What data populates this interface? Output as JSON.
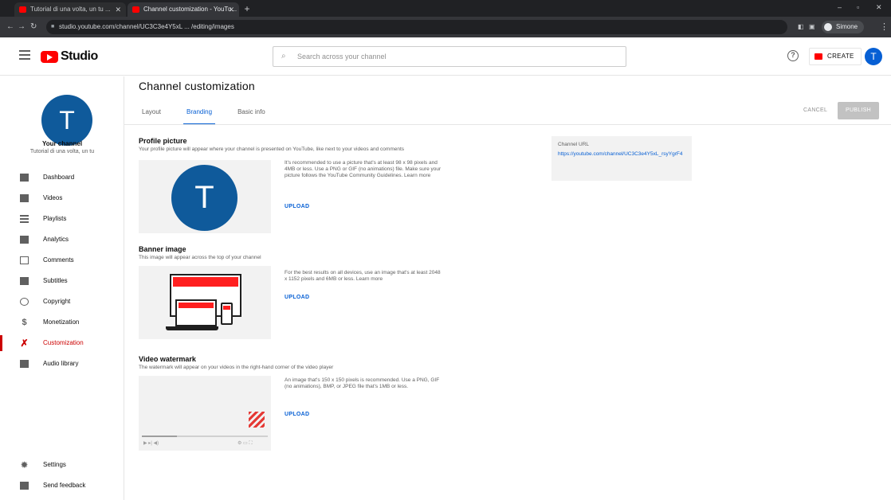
{
  "browser": {
    "tabs": [
      {
        "title": "Tutorial di una volta, un tu ..."
      },
      {
        "title": "Channel customization - YouTu..."
      }
    ],
    "new_tab": "+",
    "controls": {
      "minimize": "–",
      "maximize": "▫",
      "close": "✕"
    },
    "url": "studio.youtube.com/channel/UC3C3e4Y5xL ... /editing/images",
    "profile_label": "Simone",
    "menu": "⋮"
  },
  "header": {
    "logo_text": "Studio",
    "search_placeholder": "Search across your channel",
    "help": "?",
    "create_label": "CREATE",
    "avatar_initial": "T"
  },
  "sidebar": {
    "avatar_initial": "T",
    "channel_title": "Your channel",
    "channel_name": "Tutorial di una volta, un tu",
    "items": [
      {
        "label": "Dashboard",
        "icon": "dashboard-icon"
      },
      {
        "label": "Videos",
        "icon": "videos-icon"
      },
      {
        "label": "Playlists",
        "icon": "playlists-icon"
      },
      {
        "label": "Analytics",
        "icon": "analytics-icon"
      },
      {
        "label": "Comments",
        "icon": "comments-icon"
      },
      {
        "label": "Subtitles",
        "icon": "subtitles-icon"
      },
      {
        "label": "Copyright",
        "icon": "copyright-icon"
      },
      {
        "label": "Monetization",
        "icon": "monetization-icon"
      },
      {
        "label": "Customization",
        "icon": "customization-icon",
        "active": true
      },
      {
        "label": "Audio library",
        "icon": "audio-library-icon"
      }
    ],
    "bottom_items": [
      {
        "label": "Settings",
        "icon": "gear-icon"
      },
      {
        "label": "Send feedback",
        "icon": "feedback-icon"
      }
    ]
  },
  "main": {
    "title": "Channel customization",
    "tabs": [
      {
        "label": "Layout"
      },
      {
        "label": "Branding",
        "selected": true
      },
      {
        "label": "Basic info"
      }
    ],
    "cancel_label": "CANCEL",
    "publish_label": "PUBLISH",
    "sections": {
      "profile": {
        "title": "Profile picture",
        "desc": "Your profile picture will appear where your channel is presented on YouTube, like next to your videos and comments",
        "text": "It's recommended to use a picture that's at least 98 x 98 pixels and 4MB or less. Use a PNG or GIF (no animations) file. Make sure your picture follows the YouTube Community Guidelines. Learn more",
        "upload_label": "UPLOAD",
        "avatar_initial": "T"
      },
      "banner": {
        "title": "Banner image",
        "desc": "This image will appear across the top of your channel",
        "text": "For the best results on all devices, use an image that's at least 2048 x 1152 pixels and 6MB or less. Learn more",
        "upload_label": "UPLOAD"
      },
      "watermark": {
        "title": "Video watermark",
        "desc": "The watermark will appear on your videos in the right-hand corner of the video player",
        "text": "An image that's 150 x 150 pixels is recommended. Use a PNG, GIF (no animations), BMP, or JPEG file that's 1MB or less.",
        "upload_label": "UPLOAD",
        "progress": 0.28
      }
    },
    "channel_url": {
      "label": "Channel URL",
      "url": "https://youtube.com/channel/UC3C3e4Y5xL_rsyYgrF4"
    }
  },
  "colors": {
    "accent": "#065fd4",
    "brand_red": "#ff0000",
    "active_red": "#cc0000",
    "avatar_blue": "#0f5a9b"
  }
}
